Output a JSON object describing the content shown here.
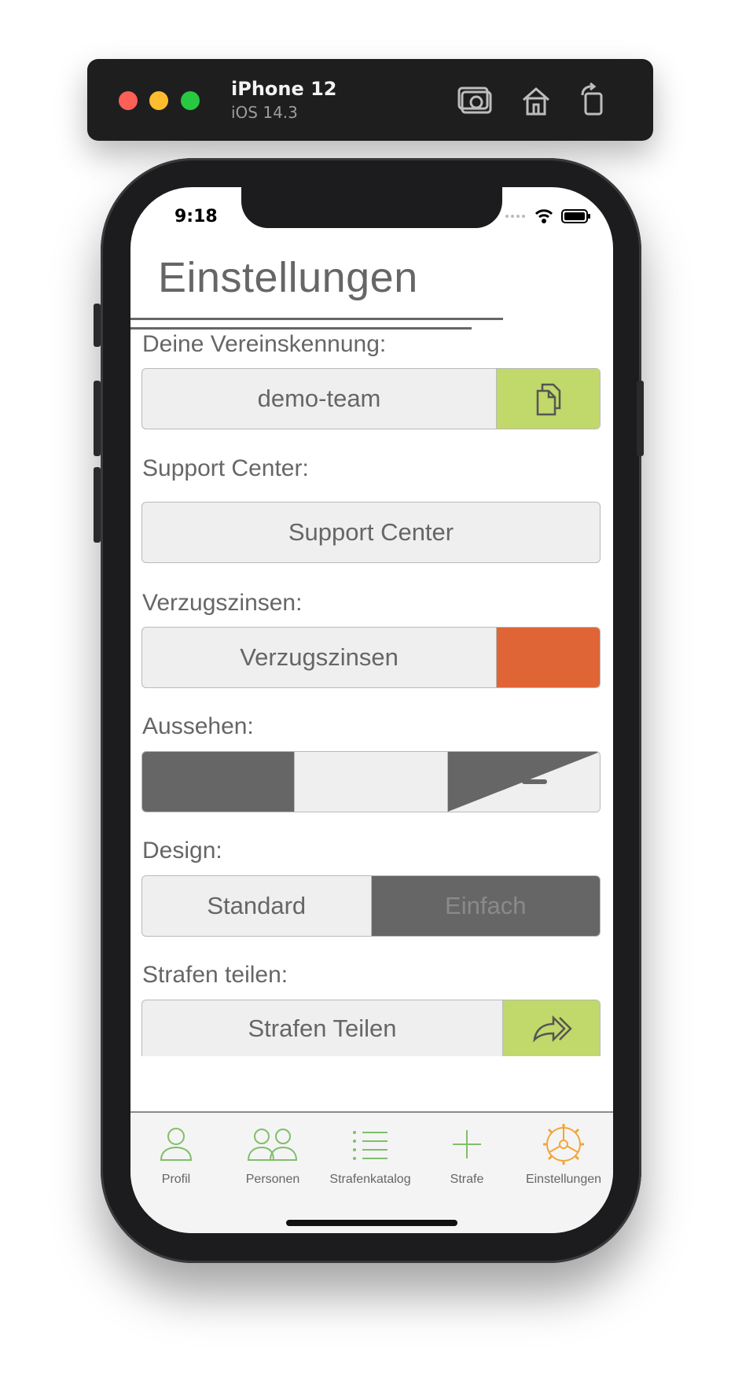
{
  "simulator": {
    "device_name": "iPhone 12",
    "os_version": "iOS 14.3",
    "icons": [
      "screenshot-icon",
      "home-icon",
      "rotate-icon"
    ]
  },
  "status_bar": {
    "time": "9:18"
  },
  "page": {
    "title": "Einstellungen",
    "sections": {
      "club_id": {
        "label": "Deine Vereinskennung:",
        "value": "demo-team",
        "action_icon": "copy-icon"
      },
      "support": {
        "label": "Support Center:",
        "button": "Support Center"
      },
      "late_interest": {
        "label": "Verzugszinsen:",
        "button": "Verzugszinsen"
      },
      "appearance": {
        "label": "Aussehen:",
        "options": [
          "dark",
          "light",
          "system"
        ]
      },
      "design": {
        "label": "Design:",
        "options": [
          "Standard",
          "Einfach"
        ],
        "selected": "Einfach"
      },
      "share": {
        "label": "Strafen teilen:",
        "button": "Strafen Teilen",
        "action_icon": "share-icon"
      }
    }
  },
  "tab_bar": {
    "items": [
      {
        "label": "Profil",
        "icon": "person-icon"
      },
      {
        "label": "Personen",
        "icon": "people-icon"
      },
      {
        "label": "Strafenkatalog",
        "icon": "list-icon"
      },
      {
        "label": "Strafe",
        "icon": "plus-icon"
      },
      {
        "label": "Einstellungen",
        "icon": "settings-icon"
      }
    ],
    "active": "Einstellungen"
  },
  "colors": {
    "accent_green": "#c1d86a",
    "accent_orange": "#e06536",
    "active_tab": "#f0a63a",
    "text_gray": "#666666"
  }
}
